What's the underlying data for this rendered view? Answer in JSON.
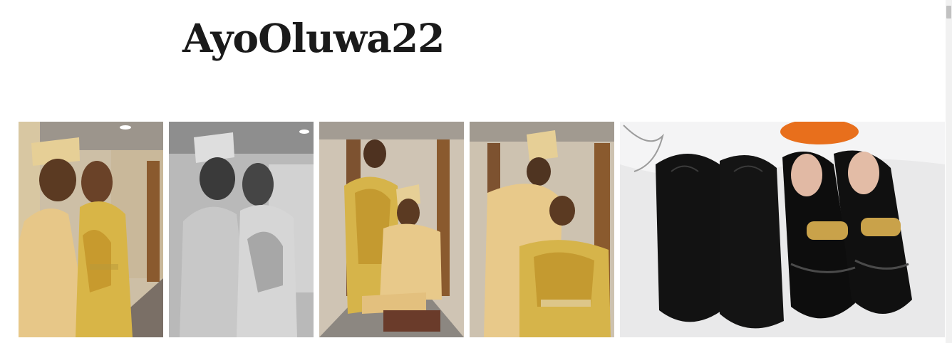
{
  "site": {
    "title": "AyoOluwa22"
  },
  "gallery": {
    "photos": [
      {
        "subject": "couple-embracing-color"
      },
      {
        "subject": "couple-embracing-monochrome"
      },
      {
        "subject": "couple-seated-standing"
      },
      {
        "subject": "couple-standing-seated"
      },
      {
        "subject": "shoes-pair-black"
      }
    ]
  },
  "colors": {
    "title": "#1a1a1a",
    "background": "#ffffff",
    "attire_cream": "#e8c98a",
    "attire_gold": "#d9b84a"
  }
}
